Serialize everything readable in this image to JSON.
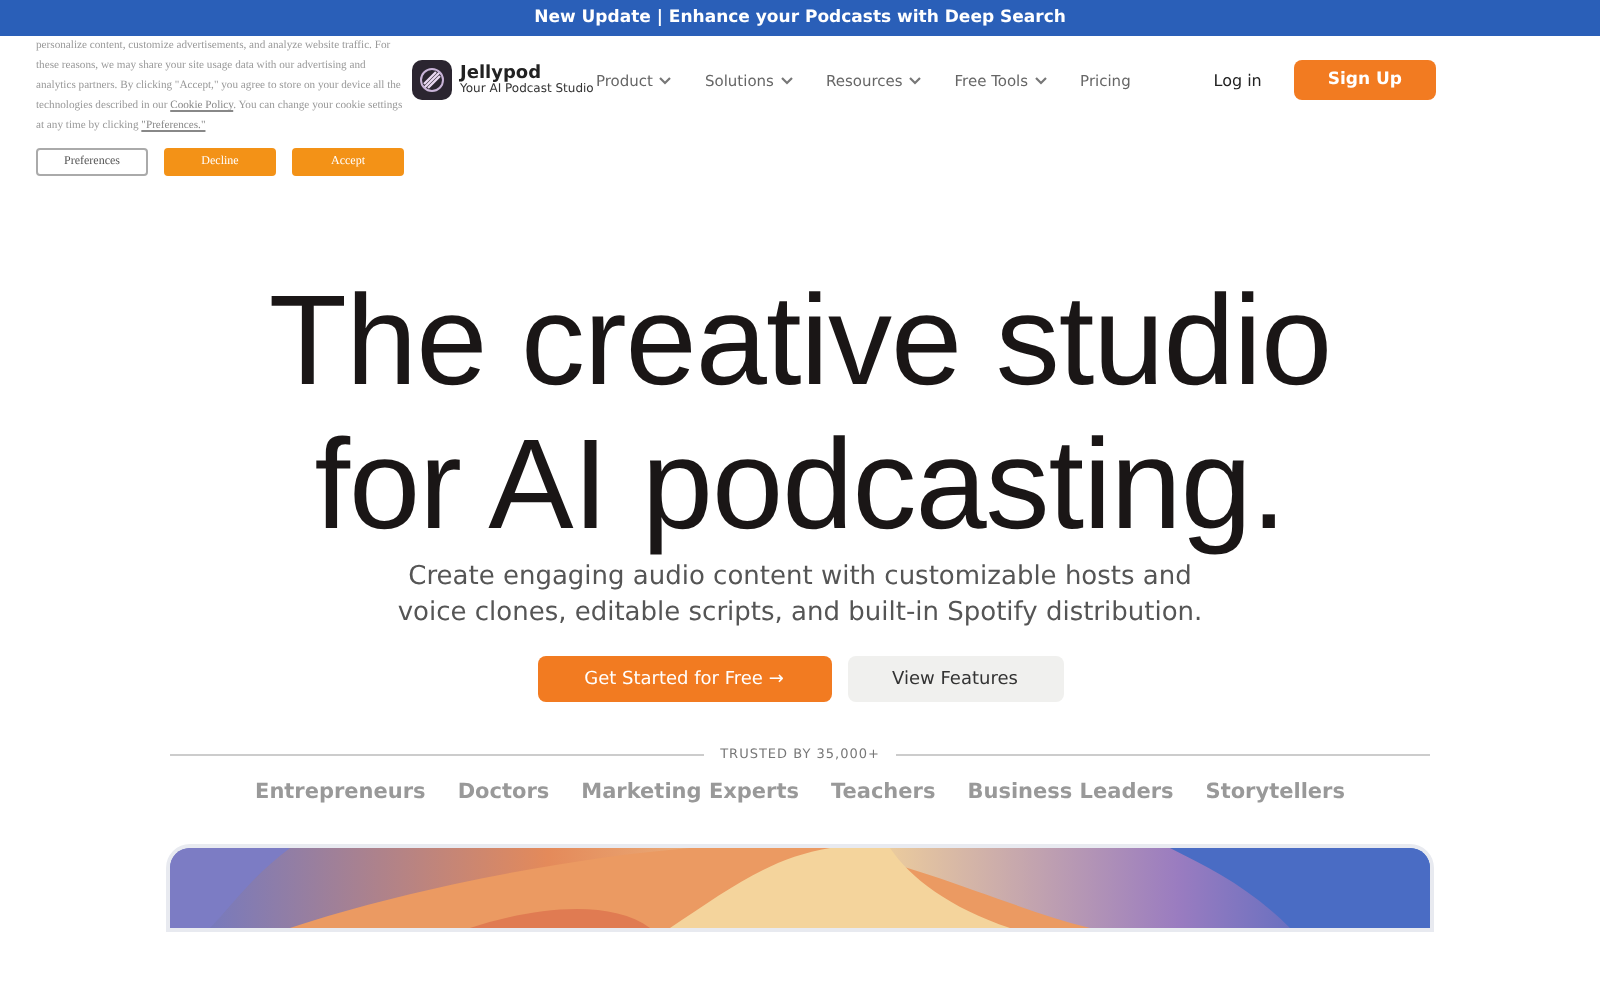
{
  "announcement": "New Update | Enhance your Podcasts with Deep Search",
  "cookie_notice": {
    "text": "personalize content, customize advertisements, and analyze website traffic. For these reasons, we may share your site usage data with our advertising and analytics partners. By clicking \"Accept,\" you agree to store on your device all the technologies described in our",
    "link": "Cookie Policy",
    "text_after": ". You can change your cookie settings at any time by clicking",
    "preferences_link": "\"Preferences.\"",
    "buttons": [
      {
        "label": "Preferences",
        "kind": "outline"
      },
      {
        "label": "Decline",
        "kind": "filled"
      },
      {
        "label": "Accept",
        "kind": "filled"
      }
    ]
  },
  "brand": {
    "name": "Jellypod",
    "tagline": "Your AI Podcast Studio"
  },
  "nav": [
    {
      "label": "Product",
      "dropdown": true
    },
    {
      "label": "Solutions",
      "dropdown": true
    },
    {
      "label": "Resources",
      "dropdown": true
    },
    {
      "label": "Free Tools",
      "dropdown": true
    },
    {
      "label": "Pricing",
      "dropdown": false
    }
  ],
  "login": "Log in",
  "signup": "Sign Up",
  "hero": {
    "title_lines": [
      "The creative studio",
      "for AI podcasting."
    ],
    "subtitle_lines": [
      "Create engaging audio content with customizable hosts and",
      "voice clones, editable scripts, and built-in Spotify distribution."
    ],
    "primary": "Get Started for Free",
    "primary_arrow": "→",
    "secondary": "View Features"
  },
  "trusted": {
    "label": "TRUSTED BY 35,000+",
    "audiences": [
      "Entrepreneurs",
      "Doctors",
      "Marketing Experts",
      "Teachers",
      "Business Leaders",
      "Storytellers"
    ]
  }
}
